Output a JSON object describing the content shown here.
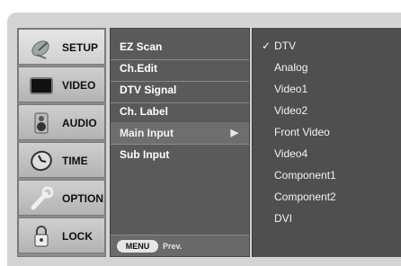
{
  "categories": [
    {
      "label": "SETUP",
      "icon": "satellite-dish-icon"
    },
    {
      "label": "VIDEO",
      "icon": "tv-screen-icon"
    },
    {
      "label": "AUDIO",
      "icon": "speaker-icon"
    },
    {
      "label": "TIME",
      "icon": "clock-icon"
    },
    {
      "label": "OPTION",
      "icon": "wrench-icon"
    },
    {
      "label": "LOCK",
      "icon": "padlock-icon"
    }
  ],
  "submenu": {
    "items": [
      "EZ Scan",
      "Ch.Edit",
      "DTV Signal",
      "Ch. Label",
      "Main Input",
      "Sub Input"
    ],
    "active_arrow": "▶",
    "footer_menu": "MENU",
    "footer_prev": "Prev."
  },
  "options": {
    "check": "✓",
    "items": [
      "DTV",
      "Analog",
      "Video1",
      "Video2",
      "Front Video",
      "Video4",
      "Component1",
      "Component2",
      "DVI"
    ]
  }
}
